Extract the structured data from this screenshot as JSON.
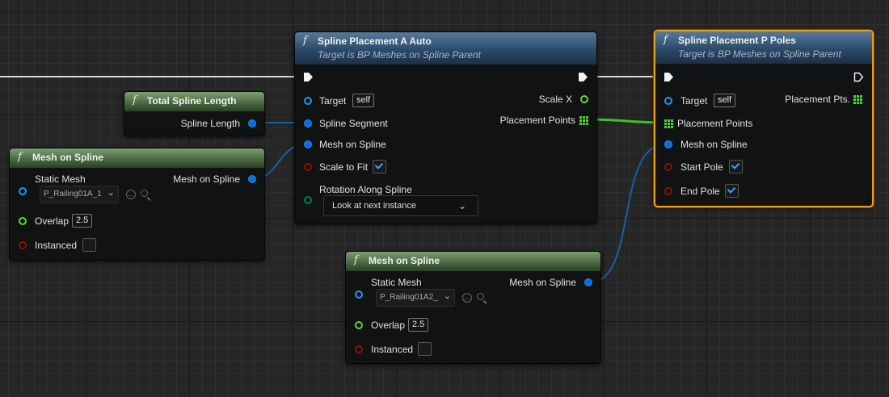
{
  "nodes": {
    "total_spline_length": {
      "title": "Total Spline Length",
      "output": "Spline Length"
    },
    "mesh_on_spline_1": {
      "title": "Mesh on Spline",
      "static_mesh_label": "Static Mesh",
      "static_mesh_value": "P_Railing01A_1",
      "output": "Mesh on Spline",
      "overlap_label": "Overlap",
      "overlap_value": "2.5",
      "instanced_label": "Instanced",
      "instanced_checked": false
    },
    "spline_placement_a": {
      "title": "Spline Placement A Auto",
      "subtitle": "Target is BP Meshes on Spline Parent",
      "target_label": "Target",
      "target_value": "self",
      "spline_segment_label": "Spline Segment",
      "mesh_on_spline_label": "Mesh on Spline",
      "scale_to_fit_label": "Scale to Fit",
      "scale_to_fit_checked": true,
      "rotation_label": "Rotation Along Spline",
      "rotation_value": "Look at next instance",
      "out_scale_x": "Scale X",
      "out_placement_points": "Placement Points"
    },
    "spline_placement_p": {
      "title": "Spline Placement P Poles",
      "subtitle": "Target is BP Meshes on Spline Parent",
      "target_label": "Target",
      "target_value": "self",
      "placement_points_label": "Placement Points",
      "mesh_on_spline_label": "Mesh on Spline",
      "start_pole_label": "Start Pole",
      "start_pole_checked": true,
      "end_pole_label": "End Pole",
      "end_pole_checked": true,
      "out_placement_pts": "Placement Pts."
    },
    "mesh_on_spline_2": {
      "title": "Mesh on Spline",
      "static_mesh_label": "Static Mesh",
      "static_mesh_value": "P_Railing01A2_",
      "output": "Mesh on Spline",
      "overlap_label": "Overlap",
      "overlap_value": "2.5",
      "instanced_label": "Instanced",
      "instanced_checked": false
    }
  },
  "icons": {
    "function": "function-icon",
    "exec": "exec-pin-icon",
    "array": "array-pin-icon",
    "browse": "browse-asset-icon",
    "search": "search-icon",
    "caret": "chevron-down-icon"
  },
  "colors": {
    "call_header": "#2b4a6a",
    "pure_header": "#4b6a44",
    "selected_border": "#f39c12",
    "object_pin": "#1d9bf0",
    "struct_pin": "#0d6fd6",
    "bool_pin": "#8b1010",
    "float_pin": "#5cd63c",
    "enum_pin": "#0f7466",
    "exec_wire": "#d8d8d8",
    "array_wire": "#3fc41e"
  },
  "symbols": {
    "fx": "f",
    "caret": "⌄",
    "browse": "←"
  }
}
